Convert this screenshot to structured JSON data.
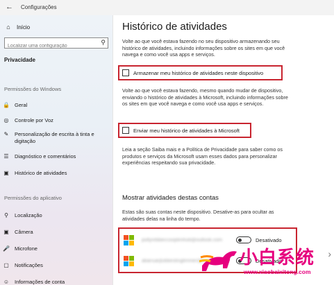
{
  "window": {
    "title": "Configurações",
    "back_icon": "arrow-left-icon"
  },
  "sidebar": {
    "home": {
      "label": "Início",
      "icon": "home-icon"
    },
    "search": {
      "placeholder": "Localizar uma configuração",
      "icon": "search-icon"
    },
    "section": "Privacidade",
    "windows_group": {
      "label": "Permissões do Windows",
      "items": [
        {
          "label": "Geral",
          "icon": "lock-icon"
        },
        {
          "label": "Controle por Voz",
          "icon": "voice-icon"
        },
        {
          "label": "Personalização de escrita à tinta e digitação",
          "icon": "pen-icon"
        },
        {
          "label": "Diagnóstico e comentários",
          "icon": "diagnostics-icon"
        },
        {
          "label": "Histórico de atividades",
          "icon": "history-icon"
        }
      ]
    },
    "app_group": {
      "label": "Permissões do aplicativo",
      "items": [
        {
          "label": "Localização",
          "icon": "location-icon"
        },
        {
          "label": "Câmera",
          "icon": "camera-icon"
        },
        {
          "label": "Microfone",
          "icon": "microphone-icon"
        },
        {
          "label": "Notificações",
          "icon": "notifications-icon"
        },
        {
          "label": "Informações de conta",
          "icon": "account-info-icon"
        }
      ]
    }
  },
  "main": {
    "title": "Histórico de atividades",
    "intro": "Volte ao que você estava fazendo no seu dispositivo armazenando seu histórico de atividades, incluindo informações sobre os sites em que você navega e como você usa apps e serviços.",
    "store_checkbox": {
      "label": "Armazenar meu histórico de atividades neste dispositivo",
      "checked": false
    },
    "send_paragraph": "Volte ao que você estava fazendo, mesmo quando mudar de dispositivo, enviando o histórico de atividades à Microsoft, incluindo informações sobre os sites em que você navega e como você usa apps e serviços.",
    "send_checkbox": {
      "label": "Enviar meu histórico de atividades à Microsoft",
      "checked": false
    },
    "privacy_paragraph": "Leia a seção Saiba mais e a Política de Privacidade para saber como os produtos e serviços da Microsoft usam esses dados para personalizar experiências respeitando sua privacidade.",
    "accounts_title": "Mostrar atividades destas contas",
    "accounts_desc": "Estas são suas contas neste dispositivo. Desative-as para ocultar as atividades delas na linha do tempo.",
    "accounts": [
      {
        "email": "pollyrebbeccooplimhoti@outlook.com",
        "toggle_label": "Desativado",
        "on": false
      },
      {
        "email": "abanuarjlubbestinglimmer@hotmail.com",
        "toggle_label": "Desativado",
        "on": false
      }
    ]
  },
  "watermark": {
    "brand": "小白系统",
    "url": "www.xiaobaixitong.com"
  },
  "colors": {
    "highlight": "#c8242f",
    "watermark": "#e6007e"
  }
}
